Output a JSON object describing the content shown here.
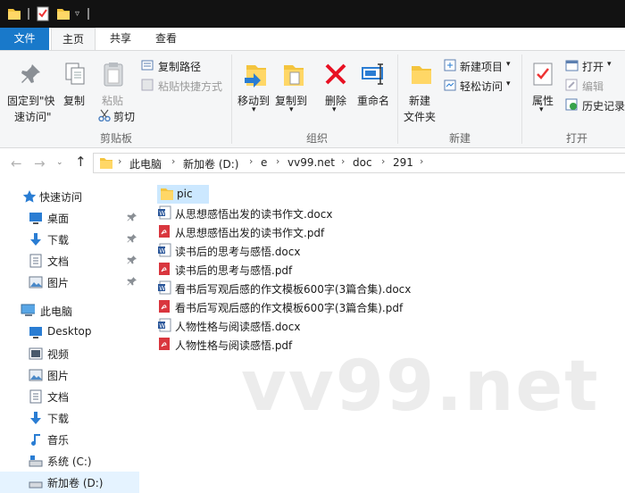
{
  "ribbon_tabs": {
    "file": "文件",
    "home": "主页",
    "share": "共享",
    "view": "查看"
  },
  "ribbon": {
    "pin_quick_access_line1": "固定到\"快",
    "pin_quick_access_line2": "速访问\"",
    "copy": "复制",
    "paste": "粘贴",
    "copy_path": "复制路径",
    "paste_shortcut": "粘贴快捷方式",
    "cut": "剪切",
    "clipboard_group": "剪贴板",
    "move_to": "移动到",
    "copy_to": "复制到",
    "delete": "删除",
    "rename": "重命名",
    "organize_group": "组织",
    "new_folder_line1": "新建",
    "new_folder_line2": "文件夹",
    "new_item": "新建项目",
    "easy_access": "轻松访问",
    "new_group": "新建",
    "properties": "属性",
    "open": "打开",
    "edit": "编辑",
    "history": "历史记录",
    "open_group": "打开"
  },
  "address": {
    "crumbs": [
      "此电脑",
      "新加卷 (D:)",
      "e",
      "vv99.net",
      "doc",
      "291"
    ]
  },
  "nav": {
    "quick_access": "快速访问",
    "qa_items": [
      "桌面",
      "下载",
      "文档",
      "图片"
    ],
    "this_pc": "此电脑",
    "pc_items": [
      "Desktop",
      "视频",
      "图片",
      "文档",
      "下载",
      "音乐",
      "系统 (C:)",
      "新加卷 (D:)"
    ]
  },
  "files": [
    {
      "name": "pic",
      "type": "folder"
    },
    {
      "name": "从思想感悟出发的读书作文.docx",
      "type": "docx"
    },
    {
      "name": "从思想感悟出发的读书作文.pdf",
      "type": "pdf"
    },
    {
      "name": "读书后的思考与感悟.docx",
      "type": "docx"
    },
    {
      "name": "读书后的思考与感悟.pdf",
      "type": "pdf"
    },
    {
      "name": "看书后写观后感的作文模板600字(3篇合集).docx",
      "type": "docx"
    },
    {
      "name": "看书后写观后感的作文模板600字(3篇合集).pdf",
      "type": "pdf"
    },
    {
      "name": "人物性格与阅读感悟.docx",
      "type": "docx"
    },
    {
      "name": "人物性格与阅读感悟.pdf",
      "type": "pdf"
    }
  ],
  "watermark": "vv99.net",
  "colors": {
    "accent": "#1979ca",
    "selection": "#cce8ff",
    "folder": "#f4c43e",
    "pdf_red": "#d9363e",
    "delete_red": "#e81123"
  }
}
